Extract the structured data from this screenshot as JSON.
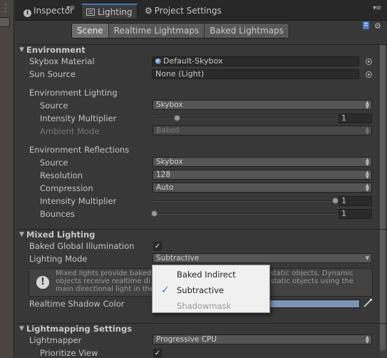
{
  "tabs": [
    {
      "label": "Inspector",
      "icon": "info-icon"
    },
    {
      "label": "Lighting",
      "icon": "lighting-icon"
    },
    {
      "label": "Project Settings",
      "icon": "gear-icon"
    }
  ],
  "subtabs": [
    "Scene",
    "Realtime Lightmaps",
    "Baked Lightmaps"
  ],
  "environment": {
    "header": "Environment",
    "skybox_material_label": "Skybox Material",
    "skybox_material_value": "Default-Skybox",
    "sun_source_label": "Sun Source",
    "sun_source_value": "None (Light)",
    "env_lighting_label": "Environment Lighting",
    "source_label": "Source",
    "source_value": "Skybox",
    "intensity_label": "Intensity Multiplier",
    "intensity_value": "1",
    "intensity_fraction": 0.125,
    "ambient_mode_label": "Ambient Mode",
    "ambient_mode_value": "Baked",
    "env_reflections_label": "Environment Reflections",
    "refl_source_label": "Source",
    "refl_source_value": "Skybox",
    "resolution_label": "Resolution",
    "resolution_value": "128",
    "compression_label": "Compression",
    "compression_value": "Auto",
    "refl_intensity_label": "Intensity Multiplier",
    "refl_intensity_value": "1",
    "refl_intensity_fraction": 1.0,
    "bounces_label": "Bounces",
    "bounces_value": "1",
    "bounces_fraction": 0.0
  },
  "mixed_lighting": {
    "header": "Mixed Lighting",
    "baked_gi_label": "Baked Global Illumination",
    "baked_gi_checked": true,
    "lighting_mode_label": "Lighting Mode",
    "lighting_mode_value": "Subtractive",
    "info_text": "Mixed lights provide baked [obscured] static objects. Dynamic objects receive realtime di[obscured] static objects using the main directional light in the [obscured]",
    "info_line1_a": "Mixed lights provide baked",
    "info_line1_b": "static objects. Dynamic",
    "info_line2_a": "objects receive realtime di",
    "info_line2_b": "static objects using the",
    "info_line3_a": "main directional light in the",
    "shadow_color_label": "Realtime Shadow Color",
    "shadow_color": "#7d93b6"
  },
  "lighting_mode_popup": {
    "items": [
      {
        "label": "Baked Indirect",
        "state": "normal"
      },
      {
        "label": "Subtractive",
        "state": "checked"
      },
      {
        "label": "Shadowmask",
        "state": "disabled"
      }
    ]
  },
  "lightmapping": {
    "header": "Lightmapping Settings",
    "lightmapper_label": "Lightmapper",
    "lightmapper_value": "Progressive CPU",
    "prioritize_label": "Prioritize View",
    "prioritize_checked": true
  },
  "colors": {
    "accent": "#3a79bb",
    "check": "#3a79d6"
  }
}
